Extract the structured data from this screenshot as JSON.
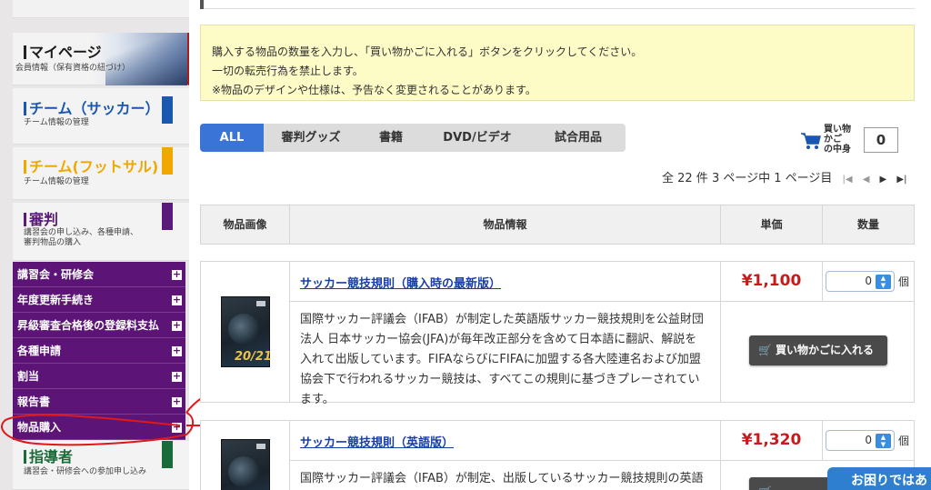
{
  "sidebar": {
    "mypage": {
      "title": "マイページ",
      "sub": "会員情報（保有資格の紐づけ）"
    },
    "soccer": {
      "title": "チーム（サッカー）",
      "sub": "チーム情報の管理",
      "color": "#1a57b0"
    },
    "futsal": {
      "title": "チーム(フットサル)",
      "sub": "チーム情報の管理",
      "color": "#f0a800"
    },
    "referee": {
      "title": "審判",
      "sub1": "講習会の申し込み、各種申請、",
      "sub2": "審判物品の購入",
      "color": "#5a1a7a"
    },
    "menu": [
      {
        "label": "講習会・研修会",
        "icon": "plus-icon"
      },
      {
        "label": "年度更新手続き",
        "icon": "plus-icon"
      },
      {
        "label": "昇級審査合格後の登録料支払",
        "icon": "plus-icon"
      },
      {
        "label": "各種申請",
        "icon": "plus-icon"
      },
      {
        "label": "割当",
        "icon": "plus-icon"
      },
      {
        "label": "報告書",
        "icon": "plus-icon"
      },
      {
        "label": "物品購入",
        "icon": "plus-icon"
      }
    ],
    "coach": {
      "title": "指導者",
      "sub": "講習会・研修会への参加申し込み",
      "color": "#1a6b3a"
    }
  },
  "notice": {
    "line1": "購入する物品の数量を入力し、「買い物かごに入れる」ボタンをクリックしてください。",
    "line2": "一切の転売行為を禁止します。",
    "line3": "※物品のデザインや仕様は、予告なく変更されることがあります。"
  },
  "tabs": [
    {
      "label": "ALL",
      "active": true
    },
    {
      "label": "審判グッズ",
      "active": false
    },
    {
      "label": "書籍",
      "active": false
    },
    {
      "label": "DVD/ビデオ",
      "active": false
    },
    {
      "label": "試合用品",
      "active": false
    }
  ],
  "cart": {
    "label_line1": "買い物かご",
    "label_line2": "の中身",
    "count": "0"
  },
  "pager": {
    "text": "全 22 件 3 ページ中 1 ページ目"
  },
  "table": {
    "headers": [
      "物品画像",
      "物品情報",
      "単価",
      "数量"
    ]
  },
  "products": [
    {
      "name": "サッカー競技規則（購入時の最新版）",
      "price": "¥1,100",
      "qty": "0",
      "unit": "個",
      "cover_year": "20/21",
      "description_lines": [
        "国際サッカー評議会（IFAB）が制定した英語版サッカー競技規則を公益財団",
        "法人 日本サッカー協会(JFA)が毎年改正部分を含めて日本語に翻訳、解説を",
        "入れて出版しています。FIFAならびにFIFAに加盟する各大陸連名および加盟",
        "協会下で行われるサッカー競技は、すべてこの規則に基づきプレーされてい",
        "ます。"
      ],
      "button": "買い物かごに入れる"
    },
    {
      "name": "サッカー競技規則（英語版）",
      "price": "¥1,320",
      "qty": "0",
      "unit": "個",
      "description_lines": [
        "国際サッカー評議会（IFAB）が制定、出版しているサッカー競技規則の英語"
      ]
    }
  ],
  "help": {
    "label": "お困りではあ"
  },
  "colors": {
    "purple_menu": "#5c1576",
    "tab_active": "#3a74d6",
    "price_red": "#c81a1a",
    "notice_bg": "#fdfbc6",
    "annotation_red": "#e0181a"
  }
}
